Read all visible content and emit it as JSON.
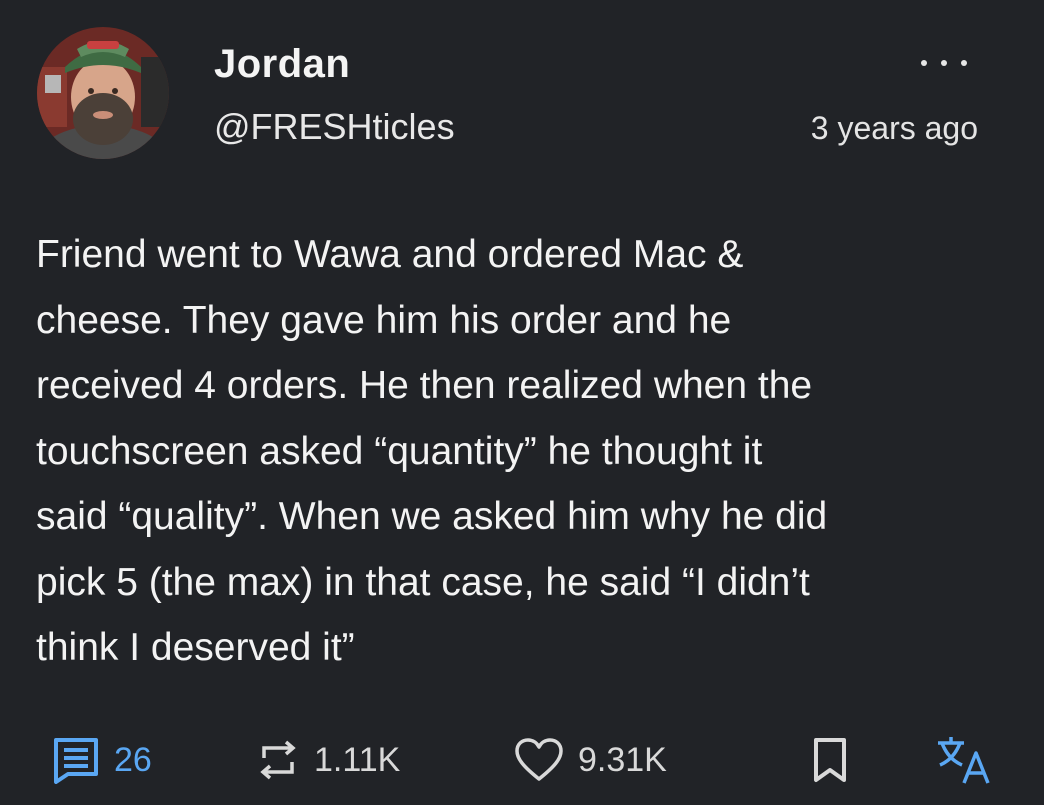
{
  "post": {
    "author": {
      "display_name": "Jordan",
      "handle": "@FRESHticles"
    },
    "timestamp": "3 years ago",
    "body": "Friend went to Wawa and ordered Mac &\ncheese. They gave him his order and he\nreceived 4 orders. He then realized when the\ntouchscreen asked “quantity” he thought it\nsaid “quality”. When we asked him why he did\npick 5 (the max) in that case, he said “I didn’t\nthink I deserved it”",
    "actions": {
      "comments": "26",
      "reposts": "1.11K",
      "likes": "9.31K"
    }
  },
  "icons": {
    "menu": "more-horizontal-icon",
    "comments": "comment-icon",
    "reposts": "repost-icon",
    "likes": "heart-icon",
    "bookmark": "bookmark-icon",
    "translate": "translate-icon"
  },
  "colors": {
    "background": "#212327",
    "accent": "#5aa7f3",
    "text": "#f1f1f1"
  }
}
